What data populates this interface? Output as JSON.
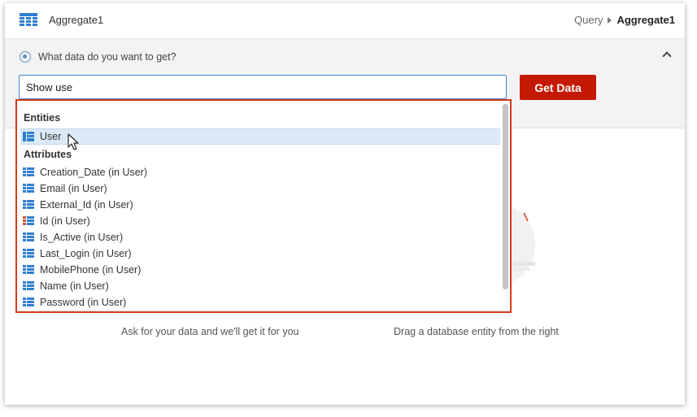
{
  "header": {
    "title": "Aggregate1",
    "breadcrumb": [
      "Query",
      "Aggregate1"
    ]
  },
  "query": {
    "prompt": "What data do you want to get?",
    "input_value": "Show use",
    "button_label": "Get Data"
  },
  "dropdown": {
    "entities_label": "Entities",
    "entities": [
      {
        "label": "User",
        "icon": "entity-icon",
        "selected": true
      }
    ],
    "attributes_label": "Attributes",
    "attributes": [
      {
        "label": "Creation_Date (in User)",
        "icon": "attribute-icon"
      },
      {
        "label": "Email (in User)",
        "icon": "attribute-icon"
      },
      {
        "label": "External_Id (in User)",
        "icon": "attribute-icon"
      },
      {
        "label": "Id (in User)",
        "icon": "identifier-attribute-icon"
      },
      {
        "label": "Is_Active (in User)",
        "icon": "attribute-icon"
      },
      {
        "label": "Last_Login (in User)",
        "icon": "attribute-icon"
      },
      {
        "label": "MobilePhone (in User)",
        "icon": "attribute-icon"
      },
      {
        "label": "Name (in User)",
        "icon": "attribute-icon"
      },
      {
        "label": "Password (in User)",
        "icon": "attribute-icon"
      }
    ]
  },
  "empty_state": {
    "left_hint": "Ask for your data and we'll get it for you",
    "right_hint": "Drag a database entity from the right"
  },
  "colors": {
    "accent_blue": "#3e86d1",
    "button_red": "#c41a05",
    "highlight_border": "#d33a1c",
    "selection_bg": "#dce9f6"
  }
}
